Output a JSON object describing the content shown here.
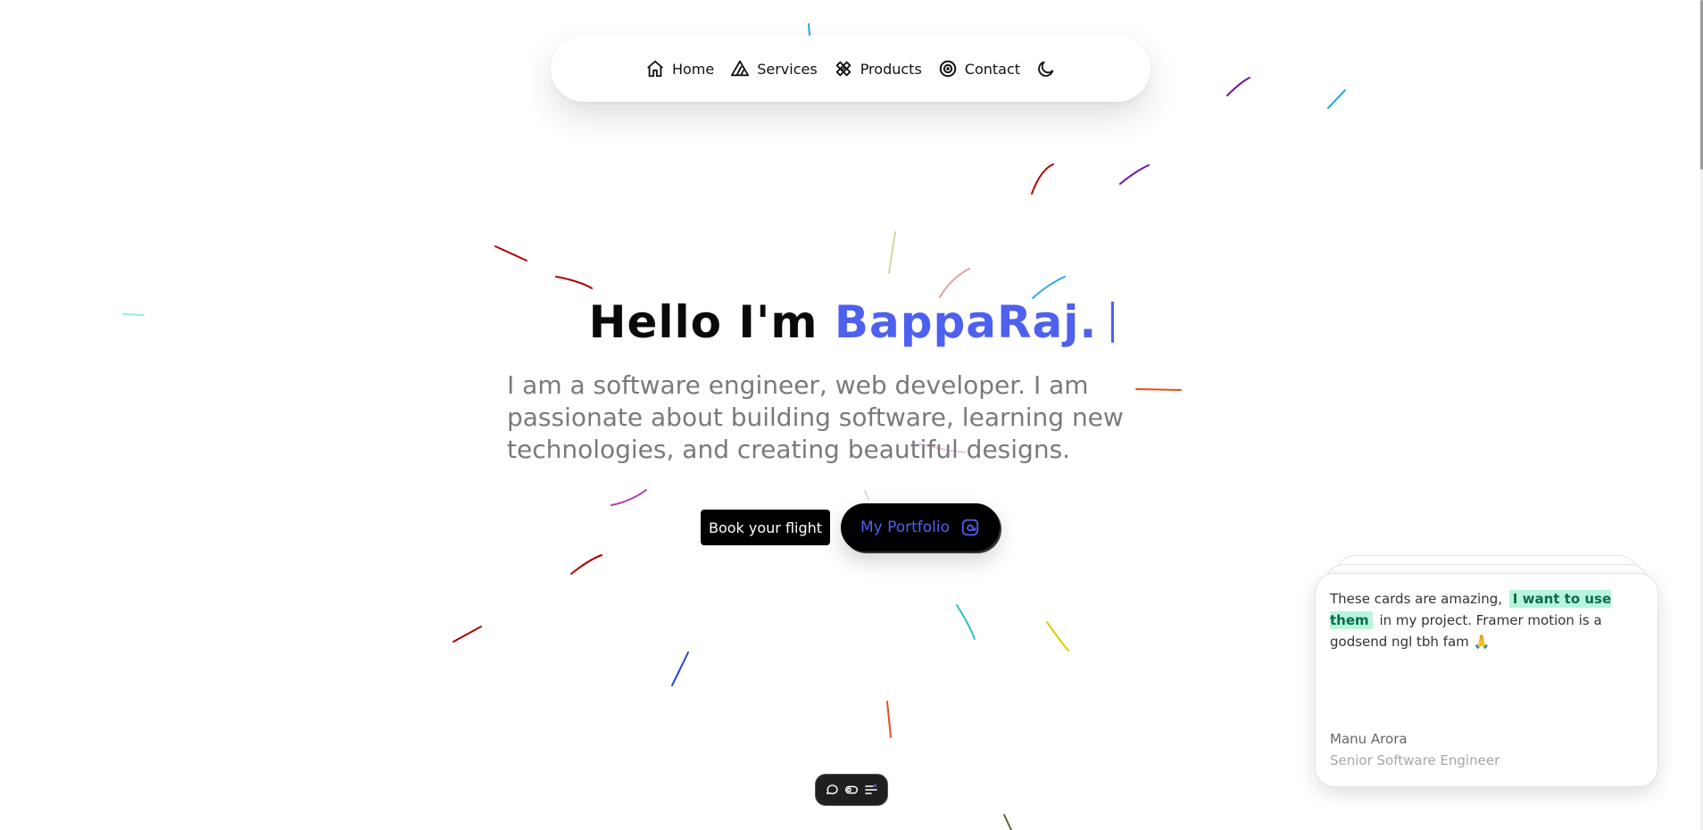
{
  "nav": {
    "items": [
      {
        "label": "Home",
        "icon": "home-icon"
      },
      {
        "label": "Services",
        "icon": "services-icon"
      },
      {
        "label": "Products",
        "icon": "products-icon"
      },
      {
        "label": "Contact",
        "icon": "contact-icon"
      }
    ],
    "theme_icon": "moon-icon"
  },
  "hero": {
    "greeting": "Hello I'm",
    "name": "BappaRaj.",
    "description": "I am a software engineer, web developer. I am passionate about building software, learning new technologies, and creating beautiful designs."
  },
  "buttons": {
    "book_label": "Book your flight",
    "portfolio_label": "My Portfolio",
    "portfolio_icon": "portfolio-icon"
  },
  "testimonial": {
    "quote_before": "These cards are amazing,",
    "quote_highlight": "I want to use them",
    "quote_after": "in my project. Framer motion is a godsend ngl tbh fam 🙏",
    "name": "Manu Arora",
    "role": "Senior Software Engineer"
  },
  "dock": {
    "icons": [
      "chat-icon",
      "toggle-icon",
      "settings-icon"
    ]
  },
  "colors": {
    "accent": "#4d61ee",
    "highlight_bg": "#b7f5dd",
    "highlight_text": "#0c6b4a",
    "button_bg": "#000000"
  }
}
